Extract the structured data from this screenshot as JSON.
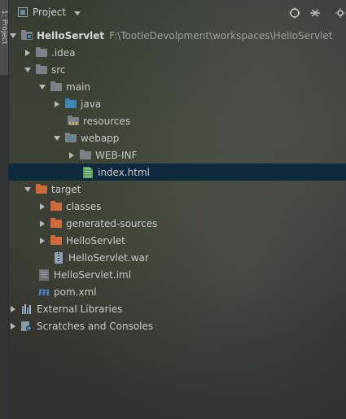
{
  "panel": {
    "strip_tab_label": "1: Project",
    "title": "Project"
  },
  "header": {
    "icons": [
      "locate-icon",
      "collapse-icon",
      "settings-icon"
    ]
  },
  "tree": [
    {
      "key": "root",
      "label": "HelloServlet",
      "path": "F:\\TootleDevolpment\\workspaces\\HelloServlet"
    },
    {
      "key": "idea",
      "label": ".idea"
    },
    {
      "key": "src",
      "label": "src"
    },
    {
      "key": "main",
      "label": "main"
    },
    {
      "key": "java",
      "label": "java"
    },
    {
      "key": "resources",
      "label": "resources"
    },
    {
      "key": "webapp",
      "label": "webapp"
    },
    {
      "key": "webinf",
      "label": "WEB-INF"
    },
    {
      "key": "index",
      "label": "index.html"
    },
    {
      "key": "target",
      "label": "target"
    },
    {
      "key": "classes",
      "label": "classes"
    },
    {
      "key": "generated",
      "label": "generated-sources"
    },
    {
      "key": "helloservlet_dir",
      "label": "HelloServlet"
    },
    {
      "key": "war",
      "label": "HelloServlet.war"
    },
    {
      "key": "iml",
      "label": "HelloServlet.iml"
    },
    {
      "key": "pom",
      "label": "pom.xml"
    },
    {
      "key": "extlibs",
      "label": "External Libraries"
    },
    {
      "key": "scratches",
      "label": "Scratches and Consoles"
    }
  ]
}
